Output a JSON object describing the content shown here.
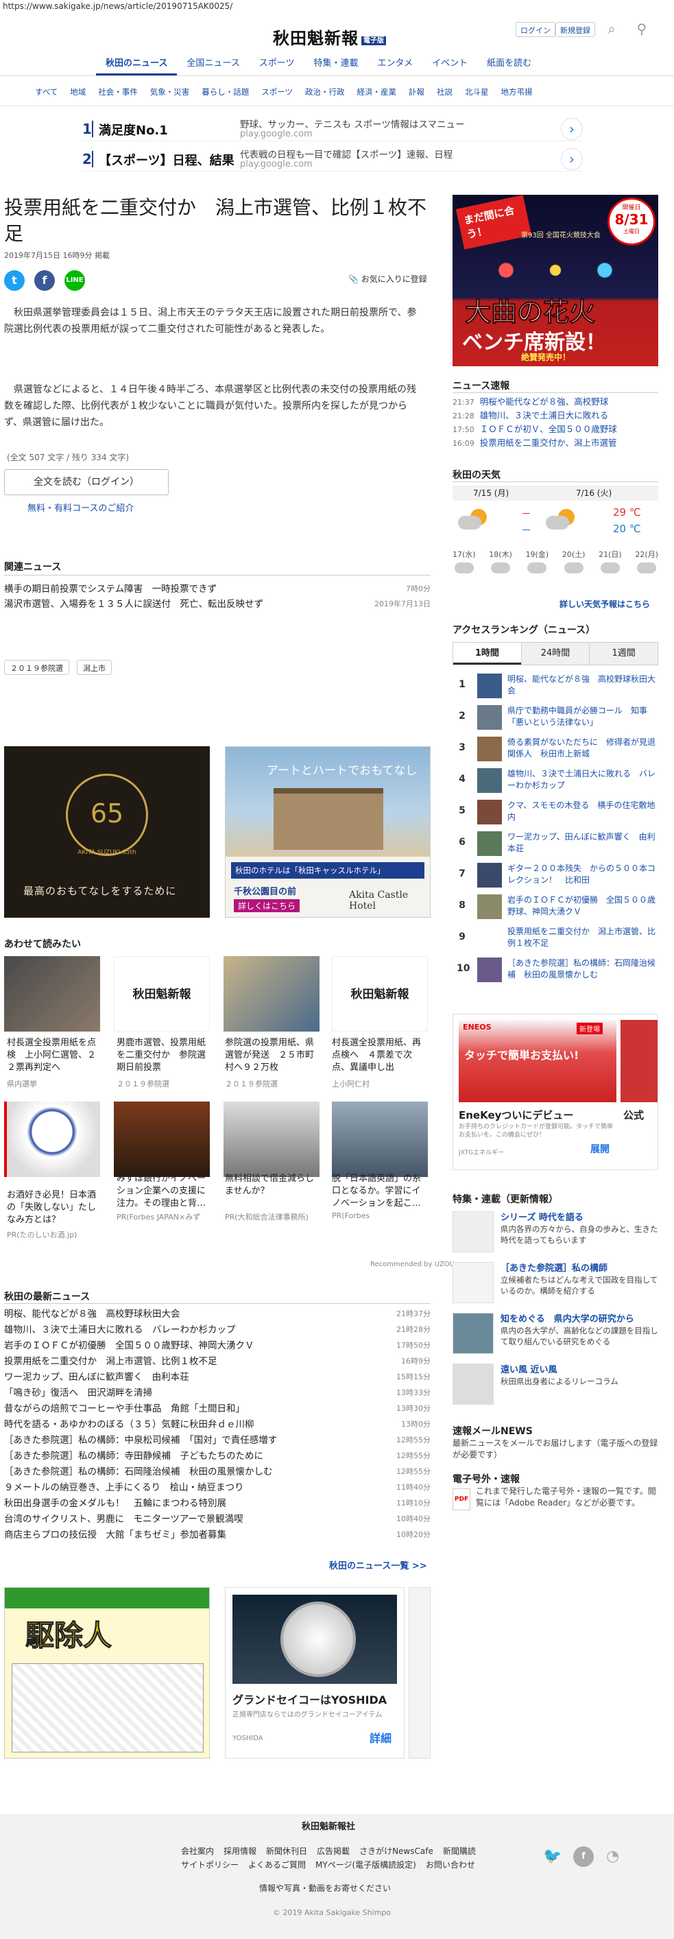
{
  "url": "https://www.sakigake.jp/news/article/20190715AK0025/",
  "header": {
    "logo": "秋田魁新報",
    "logo_badge": "電子版",
    "login": "ログイン",
    "register": "新規登録"
  },
  "main_nav": [
    "秋田のニュース",
    "全国ニュース",
    "スポーツ",
    "特集・連載",
    "エンタメ",
    "イベント",
    "紙面を読む"
  ],
  "sub_nav": [
    "すべて",
    "地域",
    "社会・事件",
    "気象・災害",
    "暮らし・話題",
    "スポーツ",
    "政治・行政",
    "経済・産業",
    "訃報",
    "社説",
    "北斗星",
    "地方弔揚"
  ],
  "ads": [
    {
      "num": "1",
      "title": "満足度No.1",
      "desc": "野球、サッカー、テニスも スポーツ情報はスマニュー",
      "site": "play.google.com"
    },
    {
      "num": "2",
      "title": "【スポーツ】日程、結果",
      "desc": "代表戦の日程も一目で確認【スポーツ】速報、日程",
      "site": "play.google.com"
    }
  ],
  "article": {
    "title": "投票用紙を二重交付か　潟上市選管、比例１枚不足",
    "date": "2019年7月15日 16時9分 掲載",
    "fav": "お気に入りに登録",
    "p1": "秋田県選挙管理委員会は１５日、潟上市天王のテラタ天王店に設置された期日前投票所で、参院選比例代表の投票用紙が誤って二重交付された可能性があると発表した。",
    "p2": "県選管などによると、１４日午後４時半ごろ、本県選挙区と比例代表の未交付の投票用紙の残数を確認した際、比例代表が１枚少ないことに職員が気付いた。投票所内を探したが見つからず、県選管に届け出た。",
    "count": "(全文 507 文字 / 残り 334 文字)",
    "read_full": "全文を読む（ログイン）",
    "course": "無料・有料コースのご紹介"
  },
  "related": {
    "heading": "関連ニュース",
    "items": [
      {
        "title": "横手の期日前投票でシステム障害　一時投票できず",
        "time": "7時0分"
      },
      {
        "title": "湯沢市選管、入場券を１３５人に誤送付　死亡、転出反映せず",
        "time": "2019年7月13日"
      }
    ]
  },
  "tags": [
    "２０１９参院選",
    "潟上市"
  ],
  "banner1": {
    "title": "最高のおもてなしをするために",
    "badge": "AKITA SUZUKI 65th"
  },
  "banner2": {
    "title": "アートとハートでおもてなし",
    "hotel": "秋田のホテルは「秋田キャッスルホテル」",
    "cta": "千秋公園目の前",
    "cta2": "詳しくはこちら",
    "brand": "Akita Castle Hotel"
  },
  "recommend": {
    "heading": "あわせて読みたい",
    "row1": [
      {
        "title": "村長選全投票用紙を点検　上小阿仁選管、２２票再判定へ",
        "sub": "県内選挙"
      },
      {
        "title": "男鹿市選管、投票用紙を二重交付か　参院選期日前投票",
        "sub": "２０１９参院選"
      },
      {
        "title": "参院選の投票用紙、県選管が発送　２５市町村へ９２万枚",
        "sub": "２０１９参院選"
      },
      {
        "title": "村長選全投票用紙、再点検へ　４票差で次点、異議申し出",
        "sub": "上小阿仁村"
      }
    ],
    "row2": [
      {
        "title": "お酒好き必見！日本酒の「失敗しない」たしなみ方とは？",
        "sub": "PR(たのしいお酒.jp)"
      },
      {
        "title": "みずほ銀行がイノベーション企業への支援に注力。その理由と背…",
        "sub": "PR(Forbes JAPAN×みず"
      },
      {
        "title": "無料相談で借金減らしませんか？",
        "sub": "PR(大和総合法律事務所)"
      },
      {
        "title": "脱「日本語英語」の糸口となるか。学習にイノベーションを起こ…",
        "sub": "PR(Forbes"
      }
    ],
    "credit": "Recommended by UZOU"
  },
  "latest": {
    "heading": "秋田の最新ニュース",
    "items": [
      {
        "title": "明桜、能代などが８強　高校野球秋田大会",
        "time": "21時37分"
      },
      {
        "title": "雄物川、３決で土浦日大に敗れる　バレーわか杉カップ",
        "time": "21時28分"
      },
      {
        "title": "岩手のＩＯＦＣが初優勝　全国５００歳野球、神岡大湧クＶ",
        "time": "17時50分"
      },
      {
        "title": "投票用紙を二重交付か　潟上市選管、比例１枚不足",
        "time": "16時9分"
      },
      {
        "title": "ワー泥カップ、田んぼに歓声響く　由利本荘",
        "time": "15時15分"
      },
      {
        "title": "「鳴き砂」復活へ　田沢湖畔を清掃",
        "time": "13時33分"
      },
      {
        "title": "昔ながらの焙煎でコーヒーや手仕事品　角館「土間日和」",
        "time": "13時30分"
      },
      {
        "title": "時代を語る・あゆかわのぼる（３５）気軽に秋田弁ｄｅ川柳",
        "time": "13時0分"
      },
      {
        "title": "［あきた参院選］私の構師：中泉松司候補　「国対」で責任感増す",
        "time": "12時55分"
      },
      {
        "title": "［あきた参院選］私の構師：寺田静候補　子どもたちのために",
        "time": "12時55分"
      },
      {
        "title": "［あきた参院選］私の構師：石岡隆治候補　秋田の風景懐かしむ",
        "time": "12時55分"
      },
      {
        "title": "９メートルの納豆巻き、上手にくるり　桧山・納豆まつり",
        "time": "11時40分"
      },
      {
        "title": "秋田出身選手の金メダルも！　五輪にまつわる特別展",
        "time": "11時10分"
      },
      {
        "title": "台湾のサイクリスト、男鹿に　モニターツアーで景観満喫",
        "time": "10時40分"
      },
      {
        "title": "商店主らプロの技伝授　大館「まちゼミ」参加者募集",
        "time": "10時20分"
      }
    ],
    "more": "秋田のニュース一覧 >>"
  },
  "bottom_ads": {
    "manga": "駆除人",
    "watch": "グランドセイコーはYOSHIDA",
    "watch_desc": "正規専門店ならではのグランドセイコーアイテム",
    "watch_shop": "YOSHIDA",
    "watch_cta": "詳細"
  },
  "sidebar": {
    "ad": {
      "line1": "まだ間に合う！",
      "line2": "大曲の花火",
      "line3": "ベンチ席新設！",
      "line4": "絶賛発売中！",
      "date": "8/31",
      "date_label": "開催日",
      "dow": "土曜日",
      "sub": "第93回 全国花火競技大会"
    },
    "flash": {
      "heading": "ニュース速報",
      "items": [
        {
          "time": "21:37",
          "title": "明桜や能代などが８強、高校野球"
        },
        {
          "time": "21:28",
          "title": "雄物川、３決で土浦日大に敗れる"
        },
        {
          "time": "17:50",
          "title": "ＩＯＦＣが初Ｖ、全国５００歳野球"
        },
        {
          "time": "16:09",
          "title": "投票用紙を二重交付か、潟上市選管"
        }
      ]
    },
    "weather": {
      "heading": "秋田の天気",
      "d1": "7/15 (月)",
      "d2": "7/16 (火)",
      "hi1": "－",
      "lo1": "－",
      "hi2": "29 ℃",
      "lo2": "20 ℃",
      "hours": [
        "17(水)",
        "18(木)",
        "19(金)",
        "20(土)",
        "21(日)",
        "22(月)"
      ],
      "link": "詳しい天気予報はこちら"
    },
    "ranking": {
      "heading": "アクセスランキング（ニュース）",
      "tabs": [
        "1時間",
        "24時間",
        "1週間"
      ],
      "items": [
        "明桜、能代などが８強　高校野球秋田大会",
        "県庁で勤務中職員が必勝コール　知事「悪いという法律ない」",
        "倚る素質がないただちに　修得者が見退　関係人　秋田市上新城",
        "雄物川、３決で土浦日大に敗れる　バレーわか杉カップ",
        "クマ、スモモの木登る　横手の住宅敷地内",
        "ワー泥カップ、田んぼに歓声響く　由利本荘",
        "ギター２００本残失　からの５００本コレクション！　比和田",
        "岩手のＩＯＦＣが初優勝　全国５００歳野球、神岡大湧クＶ",
        "投票用紙を二重交付か　潟上市選管、比例１枚不足",
        "［あきた参院選］私の構師：石岡隆治候補　秋田の風景懐かしむ"
      ]
    },
    "eneos": {
      "brand": "ENEOS",
      "badge": "新登場",
      "touch": "タッチで簡単お支払い!",
      "title": "EneKeyついにデビュー",
      "desc": "お手持ちのクレジットカードが登録可能。タッチで簡単お支払いを。この機会にぜひ！",
      "sub": "JXTGエネルギー",
      "cta": "展開",
      "title2": "公式"
    },
    "special": {
      "heading": "特集・連載（更新情報）",
      "items": [
        {
          "title": "シリーズ 時代を語る",
          "desc": "県内各界の方々から、自身の歩みと、生きた時代を語ってもらいます"
        },
        {
          "title": "［あきた参院選］私の構師",
          "desc": "立候補者たちはどんな考えで国政を目指しているのか。構師を紹介する"
        },
        {
          "title": "知をめぐる　県内大学の研究から",
          "desc": "県内の各大学が、高齢化などの課題を目指して取り組んでいる研究をめぐる"
        },
        {
          "title": "遠い風 近い風",
          "desc": "秋田県出身者によるリレーコラム"
        }
      ]
    },
    "mail": {
      "heading": "速報メールNEWS",
      "desc": "最新ニュースをメールでお届けします（電子版への登録が必要です）"
    },
    "extra": {
      "heading": "電子号外・速報",
      "desc": "これまで発行した電子号外・速報の一覧です。閲覧には「Adobe Reader」などが必要です。"
    }
  },
  "footer": {
    "company": "秋田魁新報社",
    "row1": [
      "会社案内",
      "採用情報",
      "新聞休刊日",
      "広告掲載",
      "さきがけNewsCafe",
      "新聞購読"
    ],
    "row2": [
      "サイトポリシー",
      "よくあるご質問",
      "MYページ(電子版構読設定)",
      "お問い合わせ"
    ],
    "row3": "情報や写真・動画をお寄せください",
    "copy": "© 2019 Akita Sakigake Shimpo"
  }
}
